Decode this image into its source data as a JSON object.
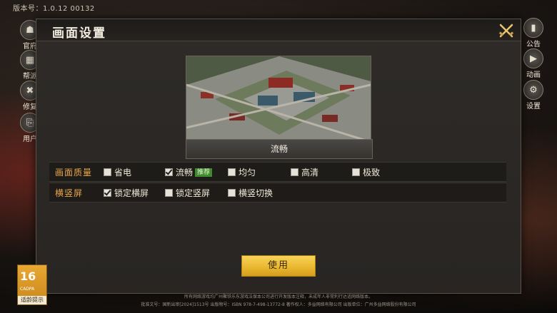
{
  "version_text": "版本号：1.0.12 00132",
  "left_menu": [
    {
      "label": "官府",
      "icon": "government-building-icon",
      "glyph": "☗"
    },
    {
      "label": "帮派",
      "icon": "faction-gate-icon",
      "glyph": "▦"
    },
    {
      "label": "修复",
      "icon": "repair-tools-icon",
      "glyph": "✖"
    },
    {
      "label": "用户",
      "icon": "user-door-icon",
      "glyph": "⎘"
    }
  ],
  "right_menu": [
    {
      "label": "公告",
      "icon": "notice-book-icon",
      "glyph": "▮"
    },
    {
      "label": "动画",
      "icon": "play-animation-icon",
      "glyph": "▶"
    },
    {
      "label": "设置",
      "icon": "settings-gear-icon",
      "glyph": "⚙"
    }
  ],
  "dialog": {
    "title": "画面设置",
    "preview_label": "流畅",
    "quality": {
      "label": "画面质量",
      "options": [
        {
          "label": "省电",
          "checked": false
        },
        {
          "label": "流畅",
          "checked": true,
          "badge": "推荐"
        },
        {
          "label": "均匀",
          "checked": false
        },
        {
          "label": "高清",
          "checked": false
        },
        {
          "label": "极致",
          "checked": false
        }
      ]
    },
    "orientation": {
      "label": "横竖屏",
      "options": [
        {
          "label": "锁定横屏",
          "checked": true
        },
        {
          "label": "锁定竖屏",
          "checked": false
        },
        {
          "label": "横竖切换",
          "checked": false
        }
      ]
    },
    "apply_label": "使用"
  },
  "age_rating": {
    "number": "16",
    "category": "CADPA",
    "tip": "适龄提示"
  },
  "footer": {
    "line1": "所有网络游戏均广州聚铁乐东游戏法保本公司进行开发版本注释，未成年人非常利行达适网络版本。",
    "line2": "批准文号：国新出审[2024]1513号   出版物号：ISBN 978-7-498-13772-8   著作权人：多益网络有限公司   出版单位：广州多益网络股份有限公司"
  },
  "colors": {
    "accent": "#e8a64a",
    "button": "#f0c23e",
    "badge": "#3f8a2e"
  }
}
